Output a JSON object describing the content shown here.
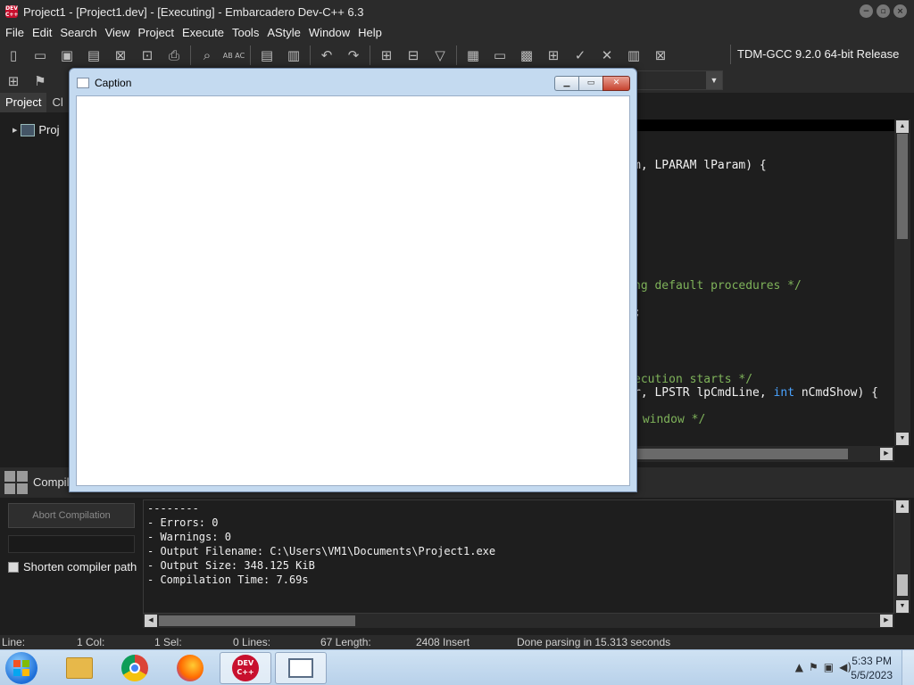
{
  "window": {
    "title": "Project1 - [Project1.dev] - [Executing] - Embarcadero Dev-C++ 6.3",
    "app_icon_text": "DEV C++"
  },
  "menu": [
    "File",
    "Edit",
    "Search",
    "View",
    "Project",
    "Execute",
    "Tools",
    "AStyle",
    "Window",
    "Help"
  ],
  "toolbar": {
    "compiler": "TDM-GCC 9.2.0 64-bit Release",
    "find_replace_icon_text": "AB AC"
  },
  "left_panel": {
    "tabs": [
      "Project",
      "Cl"
    ],
    "tree_item": "Proj"
  },
  "editor": {
    "lines": [
      {
        "text": "m, LPARAM lParam) {",
        "color": "#f0f0f0"
      },
      {
        "text": "ng default procedures */",
        "color": "#7fb35a"
      },
      {
        "text": ";",
        "color": "#f0f0f0"
      },
      {
        "text": "ecution starts */",
        "color": "#7fb35a"
      },
      {
        "text": "r, LPSTR lpCmdLine, int nCmdShow) {",
        "color": "#f0f0f0"
      },
      {
        "text": " window */",
        "color": "#7fb35a"
      }
    ],
    "keyword_color": "#4aa3ff"
  },
  "bottom": {
    "header_label": "Compil",
    "abort_label": "Abort Compilation",
    "progress": 0,
    "shorten_label": "Shorten compiler path",
    "log_lines": [
      "--------",
      "- Errors: 0",
      "- Warnings: 0",
      "- Output Filename: C:\\Users\\VM1\\Documents\\Project1.exe",
      "- Output Size: 348.125 KiB",
      "- Compilation Time: 7.69s"
    ]
  },
  "status": {
    "line": "Line:",
    "col": "1 Col:",
    "sel": "1 Sel:",
    "lines": "0 Lines:",
    "length": "67 Length:",
    "insert": "2408 Insert",
    "message": "Done parsing in 15.313 seconds"
  },
  "caption_window": {
    "title": "Caption"
  },
  "taskbar": {
    "time": "5:33 PM",
    "date": "5/5/2023",
    "devcpp_icon_text": "DEV C++"
  }
}
